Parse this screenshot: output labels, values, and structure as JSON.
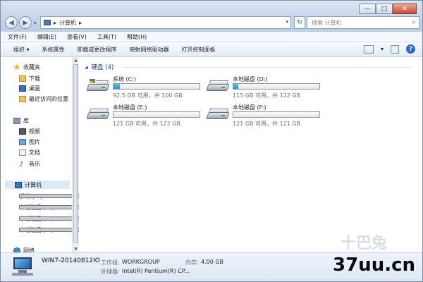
{
  "window": {
    "controls": {
      "minimize": "—",
      "maximize": "□",
      "close": "✕"
    }
  },
  "address": {
    "breadcrumb_sep": "▸",
    "location": "计算机",
    "location_suffix": "▸"
  },
  "search": {
    "placeholder": "搜索 计算机"
  },
  "menu": [
    "文件(F)",
    "编辑(E)",
    "查看(V)",
    "工具(T)",
    "帮助(H)"
  ],
  "commands": [
    {
      "label": "组织 ▾"
    },
    {
      "label": "系统属性"
    },
    {
      "label": "卸载或更改程序"
    },
    {
      "label": "映射网络驱动器"
    },
    {
      "label": "打开控制面板"
    }
  ],
  "view_menu_arrow": "▾",
  "help_label": "?",
  "nav": {
    "favorites": {
      "label": "收藏夹",
      "items": [
        "下载",
        "桌面",
        "最近访问的位置"
      ]
    },
    "libraries": {
      "label": "库",
      "items": [
        "视频",
        "图片",
        "文档",
        "音乐"
      ]
    },
    "computer": {
      "label": "计算机",
      "items": [
        "系统 (C:)",
        "本地磁盘 (D:)",
        "本地磁盘 (E:)",
        "本地磁盘 (F:)"
      ]
    },
    "network": {
      "label": "网络"
    }
  },
  "content": {
    "group_title": "硬盘 (4)",
    "drives": [
      {
        "name": "系统 (C:)",
        "free_text": "92.5 GB 可用，共 100 GB",
        "used_fraction": 0.075,
        "system": true
      },
      {
        "name": "本地磁盘 (D:)",
        "free_text": "115 GB 可用，共 122 GB",
        "used_fraction": 0.057,
        "system": false
      },
      {
        "name": "本地磁盘 (E:)",
        "free_text": "121 GB 可用，共 122 GB",
        "used_fraction": 0.0,
        "system": false
      },
      {
        "name": "本地磁盘 (F:)",
        "free_text": "121 GB 可用，共 121 GB",
        "used_fraction": 0.0,
        "system": false
      }
    ]
  },
  "details": {
    "computer_name": "WIN7-20140812IO",
    "workgroup_label": "工作组:",
    "workgroup_value": "WORKGROUP",
    "memory_label": "内存:",
    "memory_value": "4.00 GB",
    "processor_label": "处理器:",
    "processor_value": "Intel(R) Pentium(R) CP..."
  },
  "watermark": {
    "text": "37uu.cn",
    "faint_text": "十巴兔"
  }
}
